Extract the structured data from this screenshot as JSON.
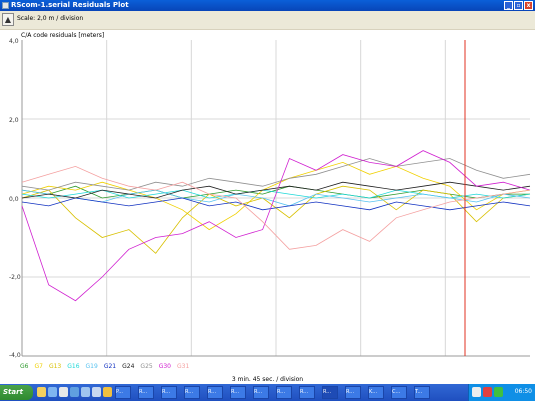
{
  "window": {
    "title": "RScom-1.serial    Residuals Plot",
    "min": "_",
    "max": "▫",
    "close": "x"
  },
  "toolbar": {
    "scale_text": "Scale: 2,0 m / division"
  },
  "plot": {
    "ylabel": "C/A code residuals [meters]",
    "yticks": [
      "4,0",
      "2,0",
      "0,0",
      "-2,0",
      "-4,0"
    ],
    "xlabel": "3 min. 45 sec. / division",
    "legend": [
      {
        "name": "G6",
        "color": "#2e9a2e"
      },
      {
        "name": "G7",
        "color": "#f0d000"
      },
      {
        "name": "G13",
        "color": "#d8c000"
      },
      {
        "name": "G16",
        "color": "#1ed8d8"
      },
      {
        "name": "G19",
        "color": "#56c2f0"
      },
      {
        "name": "G21",
        "color": "#1030c0"
      },
      {
        "name": "G24",
        "color": "#202020"
      },
      {
        "name": "G25",
        "color": "#909090"
      },
      {
        "name": "G30",
        "color": "#d020d0"
      },
      {
        "name": "G31",
        "color": "#f4a0a0"
      }
    ]
  },
  "chart_data": {
    "type": "line",
    "title": "",
    "xlabel": "3 min. 45 sec. / division",
    "ylabel": "C/A code residuals [meters]",
    "ylim": [
      -4,
      4
    ],
    "series": [
      {
        "name": "G6",
        "values": [
          0.2,
          0.1,
          0.3,
          0.0,
          0.1,
          0.2,
          0.0,
          0.1,
          0.2,
          0.1,
          0.3,
          0.2,
          0.1,
          0.0,
          0.1,
          0.2,
          0.1,
          0.0,
          0.1,
          0.1
        ]
      },
      {
        "name": "G7",
        "values": [
          0.1,
          0.3,
          0.2,
          0.4,
          0.2,
          0.0,
          -0.3,
          -0.8,
          -0.4,
          0.2,
          0.5,
          0.7,
          0.9,
          0.6,
          0.8,
          0.5,
          0.3,
          -0.3,
          0.1,
          0.2
        ]
      },
      {
        "name": "G13",
        "values": [
          0.0,
          0.2,
          -0.5,
          -1.0,
          -0.8,
          -1.4,
          -0.5,
          0.1,
          -0.2,
          0.0,
          -0.5,
          0.1,
          0.3,
          0.2,
          -0.3,
          0.2,
          0.1,
          -0.6,
          0.0,
          0.1
        ]
      },
      {
        "name": "G16",
        "values": [
          0.1,
          0.0,
          0.1,
          0.2,
          0.0,
          0.1,
          0.2,
          0.0,
          0.1,
          0.2,
          0.1,
          0.0,
          0.1,
          0.0,
          0.2,
          0.1,
          0.0,
          0.1,
          0.0,
          0.1
        ]
      },
      {
        "name": "G19",
        "values": [
          0.2,
          0.1,
          0.0,
          -0.1,
          0.1,
          0.2,
          0.0,
          -0.1,
          0.1,
          0.0,
          -0.2,
          0.1,
          0.0,
          -0.1,
          0.0,
          0.1,
          0.0,
          -0.1,
          0.1,
          0.0
        ]
      },
      {
        "name": "G21",
        "values": [
          -0.1,
          -0.2,
          0.0,
          -0.1,
          -0.2,
          -0.1,
          0.0,
          -0.2,
          -0.1,
          -0.3,
          -0.2,
          -0.1,
          -0.2,
          -0.3,
          -0.1,
          -0.2,
          -0.3,
          -0.2,
          -0.1,
          -0.2
        ]
      },
      {
        "name": "G24",
        "values": [
          0.0,
          0.1,
          0.0,
          0.2,
          0.1,
          0.0,
          0.2,
          0.3,
          0.1,
          0.2,
          0.3,
          0.2,
          0.4,
          0.3,
          0.2,
          0.3,
          0.4,
          0.3,
          0.2,
          0.3
        ]
      },
      {
        "name": "G25",
        "values": [
          0.3,
          0.2,
          0.4,
          0.3,
          0.2,
          0.4,
          0.3,
          0.5,
          0.4,
          0.3,
          0.5,
          0.6,
          0.8,
          1.0,
          0.8,
          0.9,
          1.0,
          0.7,
          0.5,
          0.6
        ]
      },
      {
        "name": "G30",
        "values": [
          -0.2,
          -2.2,
          -2.6,
          -2.0,
          -1.3,
          -1.0,
          -0.9,
          -0.6,
          -1.0,
          -0.8,
          1.0,
          0.7,
          1.1,
          0.9,
          0.8,
          1.2,
          0.9,
          0.3,
          0.4,
          0.2
        ]
      },
      {
        "name": "G31",
        "values": [
          0.4,
          0.6,
          0.8,
          0.5,
          0.3,
          0.2,
          0.4,
          0.1,
          0.0,
          -0.6,
          -1.3,
          -1.2,
          -0.8,
          -1.1,
          -0.5,
          -0.3,
          -0.1,
          0.0,
          0.1,
          0.2
        ]
      }
    ]
  },
  "taskbar": {
    "start_label": "Start",
    "clock": "06:50",
    "items": [
      "P...",
      "R...",
      "R...",
      "R...",
      "R...",
      "R...",
      "R...",
      "R...",
      "R...",
      "R...",
      "R...",
      "K...",
      "C...",
      "T..."
    ]
  }
}
